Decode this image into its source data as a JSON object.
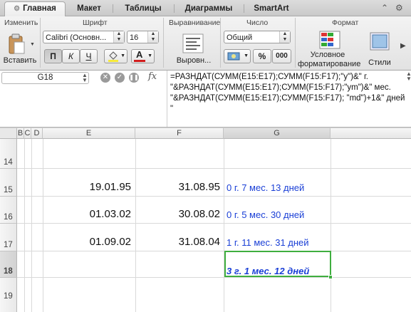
{
  "tabs": [
    "Главная",
    "Макет",
    "Таблицы",
    "Диаграммы",
    "SmartArt"
  ],
  "ribbon": {
    "groups": {
      "edit": "Изменить",
      "font": "Шрифт",
      "align": "Выравнивание",
      "number": "Число",
      "format": "Формат"
    },
    "paste_label": "Вставить",
    "font_name": "Calibri (Основн...",
    "font_size": "16",
    "bold": "П",
    "italic": "К",
    "underline": "Ч",
    "align_label": "Выровн...",
    "number_format": "Общий",
    "percent": "%",
    "thousands": "000",
    "cond_format_line1": "Условное",
    "cond_format_line2": "форматирование",
    "styles_label": "Стили"
  },
  "formula_bar": {
    "cell_ref": "G18",
    "fx": "fx",
    "formula": "=РАЗНДАТ(СУММ(E15:E17);СУММ(F15:F17);\"y\")&\" г. \"&РАЗНДАТ(СУММ(E15:E17);СУММ(F15:F17);\"ym\")&\" мес. \"&РАЗНДАТ(СУММ(E15:E17);СУММ(F15:F17); \"md\")+1&\" дней \""
  },
  "grid": {
    "columns": [
      "B",
      "C",
      "D",
      "E",
      "F",
      "G"
    ],
    "rows": [
      {
        "num": "14",
        "e": "",
        "f": "",
        "g": ""
      },
      {
        "num": "15",
        "e": "19.01.95",
        "f": "31.08.95",
        "g": "0 г. 7 мес. 13 дней"
      },
      {
        "num": "16",
        "e": "01.03.02",
        "f": "30.08.02",
        "g": "0 г. 5 мес. 30 дней"
      },
      {
        "num": "17",
        "e": "01.09.02",
        "f": "31.08.04",
        "g": "1 г. 11 мес. 31 дней"
      },
      {
        "num": "18",
        "e": "",
        "f": "",
        "g": "3 г. 1 мес. 12 дней"
      },
      {
        "num": "19",
        "e": "",
        "f": "",
        "g": ""
      }
    ],
    "selected_cell": "G18"
  },
  "colors": {
    "result_text": "#1a3fd6",
    "selection": "#3fae3f"
  }
}
